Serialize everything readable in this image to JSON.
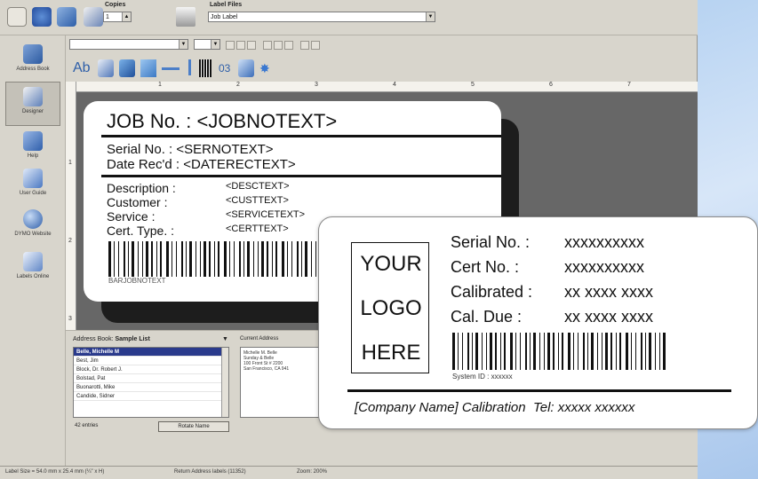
{
  "toolbar": {
    "copies_label": "Copies",
    "copies_value": "1",
    "label_files_label": "Label Files",
    "label_files_value": "Job Label"
  },
  "sidebar": {
    "items": [
      {
        "label": "Address Book",
        "icon": "address-book-icon"
      },
      {
        "label": "Designer",
        "icon": "designer-icon"
      },
      {
        "label": "Help",
        "icon": "help-icon"
      },
      {
        "label": "User Guide",
        "icon": "user-guide-icon"
      },
      {
        "label": "DYMO Website",
        "icon": "globe-icon"
      },
      {
        "label": "Labels Online",
        "icon": "labels-online-icon"
      }
    ]
  },
  "ruler": {
    "h_ticks": [
      "1",
      "2",
      "3",
      "4",
      "5",
      "6",
      "7"
    ],
    "v_ticks": [
      "1",
      "2",
      "3"
    ]
  },
  "job_label": {
    "title": "JOB No. : <JOBNOTEXT>",
    "serial": "Serial No. :  <SERNOTEXT>",
    "date": "Date Rec'd : <DATERECTEXT>",
    "desc_key": "Description :",
    "desc_val": "<DESCTEXT>",
    "cust_key": "Customer :",
    "cust_val": "<CUSTTEXT>",
    "service_key": "Service :",
    "service_val": "<SERVICETEXT>",
    "cert_key": "Cert. Type. :",
    "cert_val": "<CERTTEXT>",
    "barcode_text": "BARJOBNOTEXT"
  },
  "address_book": {
    "header_label": "Address Book:",
    "list_name": "Sample List",
    "entries": [
      "Belle, Michelle M",
      "Best, Jim",
      "Block, Dr. Robert J.",
      "Bolstad, Pat",
      "Buonarotti, Mike",
      "Candide, Sidner"
    ],
    "count": "42 entries",
    "rotate_button": "Rotate Name"
  },
  "current_address": {
    "header": "Current Address",
    "lines": [
      "Michelle M. Belle",
      "Sunday & Belle",
      "100 Front St # 2200",
      "San Francisco, CA 941"
    ]
  },
  "status_bar": {
    "label_size": "Label Size = 54.0 mm x 25.4 mm (¼\" x H)",
    "label_type": "Return Address labels (11352)",
    "zoom": "Zoom: 200%"
  },
  "cal_label": {
    "logo": [
      "YOUR",
      "LOGO",
      "HERE"
    ],
    "rows": [
      {
        "key": "Serial No. :",
        "value": "xxxxxxxxxx"
      },
      {
        "key": "Cert No. :",
        "value": "xxxxxxxxxx"
      },
      {
        "key": "Calibrated :",
        "value": "xx xxxx xxxx"
      },
      {
        "key": "Cal. Due :",
        "value": "xx xxxx xxxx"
      }
    ],
    "system_id": "System ID :  xxxxxx",
    "footer_company": "[Company Name] Calibration",
    "footer_tel": "Tel: xxxxx xxxxxx"
  },
  "colors": {
    "app_bg": "#d8d5cc",
    "canvas": "#676767",
    "selection": "#2a3a8c",
    "desktop_blue": "#b9d4f2"
  }
}
